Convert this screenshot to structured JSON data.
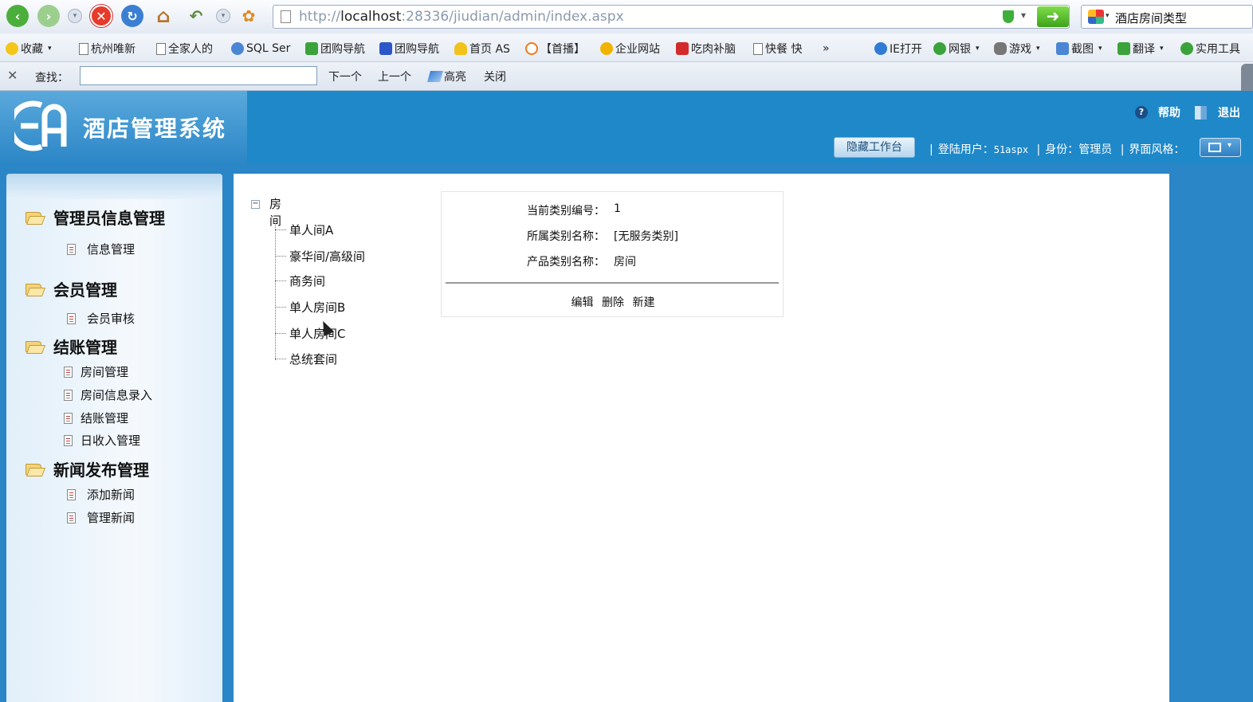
{
  "browser": {
    "address_url_prefix": "http://",
    "address_url_host": "localhost",
    "address_url_rest": ":28336/jiudian/admin/index.aspx",
    "search_text": "酒店房间类型",
    "bookmarks_left": [
      "收藏",
      "杭州唯新",
      "全家人的",
      "SQL Ser",
      "团购导航",
      "团购导航",
      "首页 AS",
      "【首播】",
      "企业网站",
      "吃肉补脑",
      "快餐 快"
    ],
    "bookmarks_more": "»",
    "bookmarks_right": [
      "IE打开",
      "网银",
      "游戏",
      "截图",
      "翻译",
      "实用工具"
    ],
    "find_label": "查找：",
    "find_value": "",
    "find_next": "下一个",
    "find_prev": "上一个",
    "find_highlight": "高亮",
    "find_close": "关闭"
  },
  "header": {
    "logo_text": "EA",
    "title": "酒店管理系统",
    "help": "帮助",
    "logout": "退出",
    "hide_workspace": "隐藏工作台",
    "login_user_label": "登陆用户：",
    "login_user": "51aspx",
    "role_label": "身份：",
    "role": "管理员",
    "style_label": "界面风格："
  },
  "sidebar": {
    "groups": [
      {
        "title": "管理员信息管理",
        "items": [
          "信息管理"
        ]
      },
      {
        "title": "会员管理",
        "items": [
          "会员审核"
        ]
      },
      {
        "title": "结账管理",
        "items": [
          "房间管理",
          "房间信息录入",
          "结账管理",
          "日收入管理"
        ]
      },
      {
        "title": "新闻发布管理",
        "items": [
          "添加新闻",
          "管理新闻"
        ]
      }
    ]
  },
  "tree": {
    "root": "房间",
    "toggle": "−",
    "children": [
      "单人间A",
      "豪华间/高级间",
      "商务间",
      "单人房间B",
      "单人房间C",
      "总统套间"
    ]
  },
  "detail": {
    "current_id_label": "当前类别编号：",
    "current_id": "1",
    "parent_label": "所属类别名称：",
    "parent": "[无服务类别]",
    "name_label": "产品类别名称：",
    "name": "房间",
    "actions": [
      "编辑",
      "删除",
      "新建"
    ]
  },
  "colors": {
    "brand_blue": "#2a86c6",
    "header_blue": "#1e88c9"
  }
}
